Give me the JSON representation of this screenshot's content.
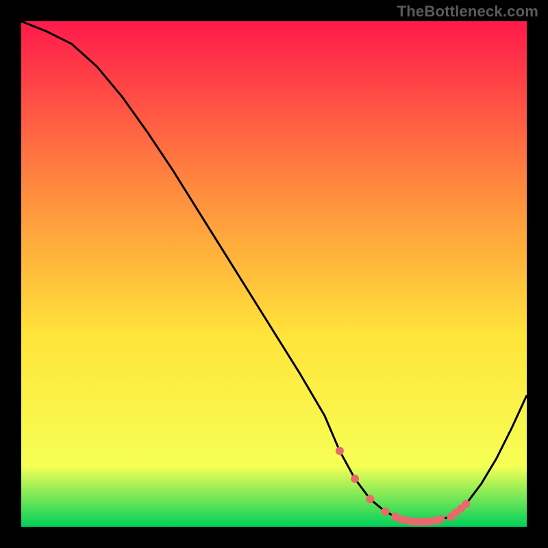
{
  "watermark": {
    "text": "TheBottleneck.com"
  },
  "colors": {
    "background": "#000000",
    "curve": "#000000",
    "marker_fill": "#e86a6a",
    "marker_stroke": "#e86a6a",
    "gradient_top": "#ff1a4b",
    "gradient_mid1": "#ff8a3e",
    "gradient_mid2": "#ffe43a",
    "gradient_mid3": "#f6ff55",
    "gradient_bottom": "#00d05a"
  },
  "chart_data": {
    "type": "line",
    "title": "",
    "xlabel": "",
    "ylabel": "",
    "xlim": [
      0,
      100
    ],
    "ylim": [
      0,
      100
    ],
    "grid": false,
    "legend": null,
    "series": [
      {
        "name": "bottleneck-curve",
        "x": [
          0,
          5,
          10,
          15,
          20,
          25,
          30,
          35,
          40,
          45,
          50,
          55,
          60,
          63,
          66,
          69,
          72,
          74,
          76,
          78,
          80,
          82,
          85,
          88,
          91,
          94,
          97,
          100
        ],
        "y": [
          100,
          98,
          95.5,
          91,
          85,
          78,
          70.5,
          62.5,
          54.5,
          46.5,
          38.5,
          30.5,
          22,
          15,
          9.5,
          5.5,
          3,
          2,
          1.3,
          1,
          1,
          1.2,
          2,
          4.5,
          8.5,
          13.5,
          19.5,
          26
        ]
      }
    ],
    "markers": {
      "name": "sweet-spot",
      "x": [
        63,
        66,
        69,
        72,
        74,
        75,
        76,
        77,
        78,
        79,
        80,
        81,
        82,
        83,
        85,
        86,
        87,
        88
      ],
      "y": [
        15,
        9.5,
        5.5,
        3,
        2,
        1.5,
        1.3,
        1.1,
        1,
        1,
        1,
        1.1,
        1.2,
        1.5,
        2,
        2.8,
        3.6,
        4.5
      ]
    }
  }
}
